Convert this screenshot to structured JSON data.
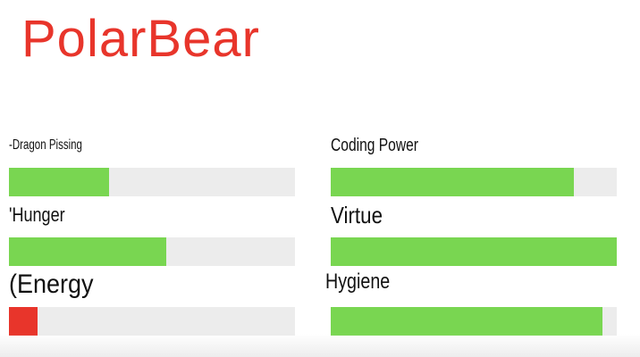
{
  "app": {
    "title": "PolarBear"
  },
  "colors": {
    "title": "#e8352b",
    "healthy": "#79d651",
    "critical": "#e8352b",
    "track": "#ececec"
  },
  "stats": [
    {
      "label": "-Dragon Pissing",
      "fraction": 0.35,
      "color": "#79d651"
    },
    {
      "label": "Coding Power",
      "fraction": 0.85,
      "color": "#79d651"
    },
    {
      "label": "'Hunger",
      "fraction": 0.55,
      "color": "#79d651"
    },
    {
      "label": "Virtue",
      "fraction": 1.0,
      "color": "#79d651"
    },
    {
      "label": "(Energy",
      "fraction": 0.1,
      "color": "#e8352b"
    },
    {
      "label": "Hygiene",
      "fraction": 0.95,
      "color": "#79d651"
    }
  ]
}
